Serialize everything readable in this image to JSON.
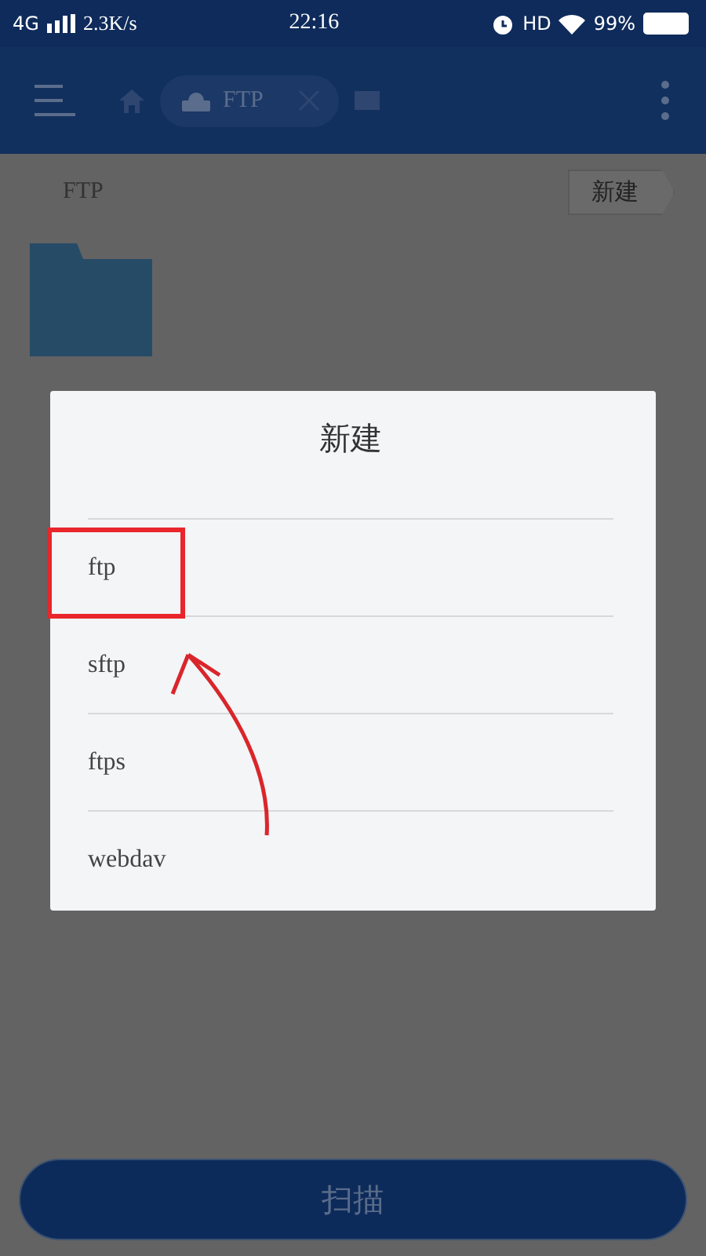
{
  "status_bar": {
    "network": "4G",
    "speed": "2.3K/s",
    "time": "22:16",
    "hd": "HD",
    "battery": "99%"
  },
  "toolbar": {
    "tab": {
      "label": "FTP"
    }
  },
  "breadcrumb": "FTP",
  "new_button": "新建",
  "dialog": {
    "title": "新建",
    "options": [
      {
        "label": "ftp",
        "highlighted": true
      },
      {
        "label": "sftp",
        "highlighted": false
      },
      {
        "label": "ftps",
        "highlighted": false
      },
      {
        "label": "webdav",
        "highlighted": false
      }
    ]
  },
  "scan_button": "扫描"
}
